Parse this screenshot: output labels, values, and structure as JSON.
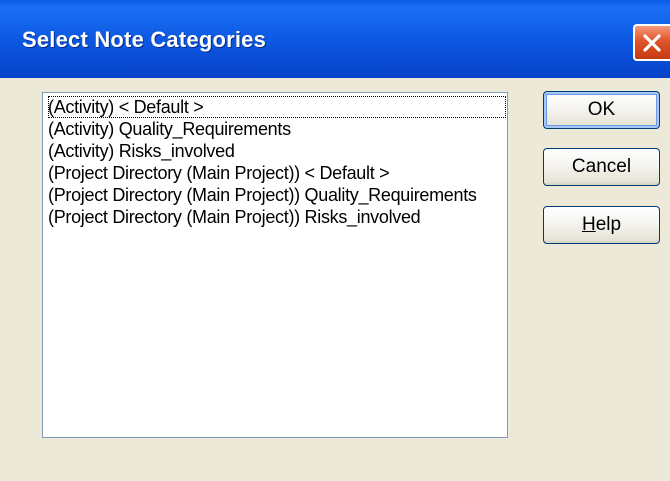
{
  "dialog": {
    "title": "Select Note Categories",
    "close_icon": "close-icon"
  },
  "list": {
    "items": [
      "(Activity) < Default >",
      "(Activity) Quality_Requirements",
      "(Activity) Risks_involved",
      "(Project Directory (Main Project)) < Default >",
      "(Project Directory (Main Project)) Quality_Requirements",
      "(Project Directory (Main Project)) Risks_involved"
    ],
    "focused_index": 0
  },
  "buttons": {
    "ok": "OK",
    "cancel": "Cancel",
    "help_mnemonic": "H",
    "help_rest": "elp"
  },
  "colors": {
    "title_bar": "#0b56e0",
    "close_button": "#e0542a",
    "dialog_background": "#ece9d8"
  }
}
